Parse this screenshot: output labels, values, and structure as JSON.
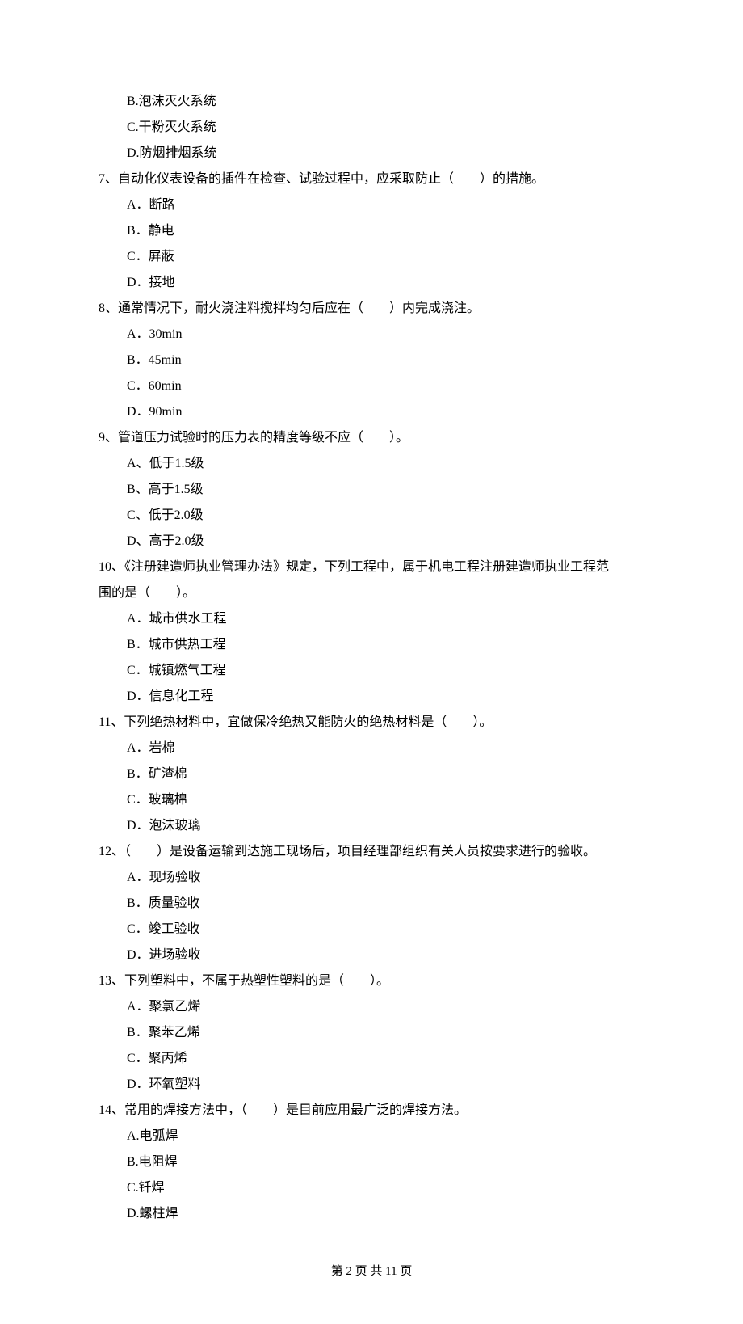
{
  "prevTail": {
    "opts": [
      "B.泡沫灭火系统",
      "C.干粉灭火系统",
      "D.防烟排烟系统"
    ]
  },
  "q7": {
    "stem": "7、自动化仪表设备的插件在检查、试验过程中，应采取防止（　　）的措施。",
    "opts": [
      "A．断路",
      "B．静电",
      "C．屏蔽",
      "D．接地"
    ]
  },
  "q8": {
    "stem": "8、通常情况下，耐火浇注料搅拌均匀后应在（　　）内完成浇注。",
    "opts": [
      "A．30min",
      "B．45min",
      "C．60min",
      "D．90min"
    ]
  },
  "q9": {
    "stem": "9、管道压力试验时的压力表的精度等级不应（　　）。",
    "opts": [
      "A、低于1.5级",
      "B、高于1.5级",
      "C、低于2.0级",
      "D、高于2.0级"
    ]
  },
  "q10": {
    "stem1": "10、《注册建造师执业管理办法》规定，下列工程中，属于机电工程注册建造师执业工程范",
    "stem2": "围的是（　　）。",
    "opts": [
      "A．城市供水工程",
      "B．城市供热工程",
      "C．城镇燃气工程",
      "D．信息化工程"
    ]
  },
  "q11": {
    "stem": "11、下列绝热材料中，宜做保冷绝热又能防火的绝热材料是（　　）。",
    "opts": [
      "A．岩棉",
      "B．矿渣棉",
      "C．玻璃棉",
      "D．泡沫玻璃"
    ]
  },
  "q12": {
    "stem": "12、（　　）是设备运输到达施工现场后，项目经理部组织有关人员按要求进行的验收。",
    "opts": [
      "A．现场验收",
      "B．质量验收",
      "C．竣工验收",
      "D．进场验收"
    ]
  },
  "q13": {
    "stem": "13、下列塑料中，不属于热塑性塑料的是（　　）。",
    "opts": [
      "A．聚氯乙烯",
      "B．聚苯乙烯",
      "C．聚丙烯",
      "D．环氧塑料"
    ]
  },
  "q14": {
    "stem": "14、常用的焊接方法中，（　　）是目前应用最广泛的焊接方法。",
    "opts": [
      "A.电弧焊",
      "B.电阻焊",
      "C.钎焊",
      "D.螺柱焊"
    ]
  },
  "footer": "第 2 页 共 11 页"
}
